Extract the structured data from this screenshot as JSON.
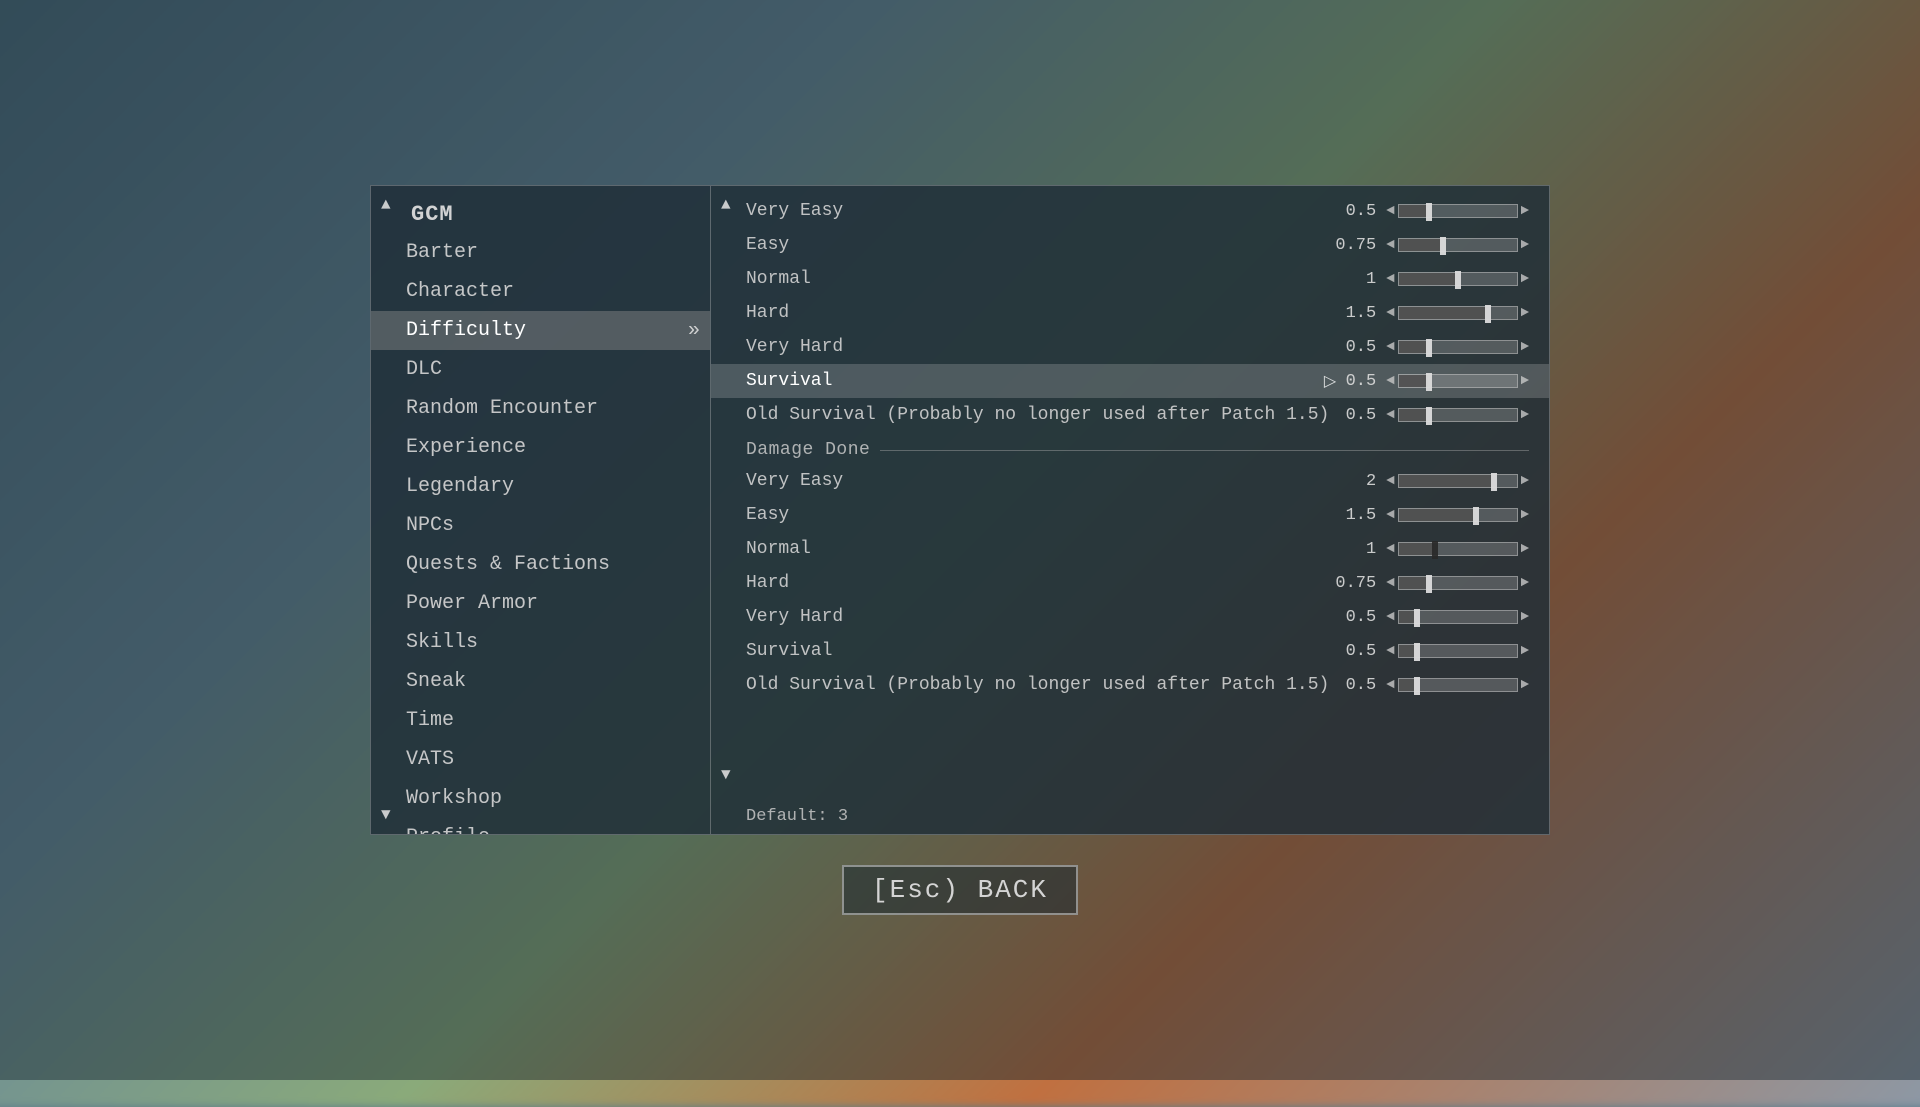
{
  "background": {
    "colors": [
      "#4a6a7a",
      "#6a8a9a",
      "#8aaa7a",
      "#c07040"
    ]
  },
  "left_panel": {
    "collapse_up": "▲",
    "collapse_down": "▼",
    "gcm_label": "GCM",
    "menu_items": [
      {
        "id": "barter",
        "label": "Barter",
        "active": false
      },
      {
        "id": "character",
        "label": "Character",
        "active": false
      },
      {
        "id": "difficulty",
        "label": "Difficulty",
        "active": true
      },
      {
        "id": "dlc",
        "label": "DLC",
        "active": false
      },
      {
        "id": "random-encounter",
        "label": "Random Encounter",
        "active": false
      },
      {
        "id": "experience",
        "label": "Experience",
        "active": false
      },
      {
        "id": "legendary",
        "label": "Legendary",
        "active": false
      },
      {
        "id": "npcs",
        "label": "NPCs",
        "active": false
      },
      {
        "id": "quests-factions",
        "label": "Quests & Factions",
        "active": false
      },
      {
        "id": "power-armor",
        "label": "Power Armor",
        "active": false
      },
      {
        "id": "skills",
        "label": "Skills",
        "active": false
      },
      {
        "id": "sneak",
        "label": "Sneak",
        "active": false
      },
      {
        "id": "time",
        "label": "Time",
        "active": false
      },
      {
        "id": "vats",
        "label": "VATS",
        "active": false
      },
      {
        "id": "workshop",
        "label": "Workshop",
        "active": false
      },
      {
        "id": "profile",
        "label": "Profile",
        "active": false
      }
    ]
  },
  "right_panel": {
    "scroll_up": "▲",
    "scroll_down": "▼",
    "sections": [
      {
        "id": "damage-taken",
        "header": null,
        "rows": [
          {
            "id": "dt-very-easy",
            "name": "Very Easy",
            "value": "0.5",
            "slider_pct": 25,
            "selected": false
          },
          {
            "id": "dt-easy",
            "name": "Easy",
            "value": "0.75",
            "slider_pct": 37,
            "selected": false
          },
          {
            "id": "dt-normal",
            "name": "Normal",
            "value": "1",
            "slider_pct": 50,
            "selected": false
          },
          {
            "id": "dt-hard",
            "name": "Hard",
            "value": "1.5",
            "slider_pct": 75,
            "selected": false
          },
          {
            "id": "dt-very-hard",
            "name": "Very Hard",
            "value": "0.5",
            "slider_pct": 25,
            "selected": false
          },
          {
            "id": "dt-survival",
            "name": "Survival",
            "value": "0.5",
            "slider_pct": 25,
            "selected": true,
            "cursor": true
          },
          {
            "id": "dt-old-survival",
            "name": "Old Survival (Probably no longer used after Patch 1.5)",
            "value": "0.5",
            "slider_pct": 25,
            "selected": false
          }
        ]
      },
      {
        "id": "damage-done",
        "header": "Damage Done",
        "rows": [
          {
            "id": "dd-very-easy",
            "name": "Very Easy",
            "value": "2",
            "slider_pct": 80,
            "selected": false
          },
          {
            "id": "dd-easy",
            "name": "Easy",
            "value": "1.5",
            "slider_pct": 65,
            "selected": false
          },
          {
            "id": "dd-normal",
            "name": "Normal",
            "value": "1",
            "slider_pct": 30,
            "selected": false,
            "dark_thumb": true
          },
          {
            "id": "dd-hard",
            "name": "Hard",
            "value": "0.75",
            "slider_pct": 25,
            "selected": false
          },
          {
            "id": "dd-very-hard",
            "name": "Very Hard",
            "value": "0.5",
            "slider_pct": 15,
            "selected": false
          },
          {
            "id": "dd-survival",
            "name": "Survival",
            "value": "0.5",
            "slider_pct": 15,
            "selected": false
          },
          {
            "id": "dd-old-survival",
            "name": "Old Survival (Probably no longer used after Patch 1.5)",
            "value": "0.5",
            "slider_pct": 15,
            "selected": false
          }
        ]
      }
    ],
    "default_text": "Default: 3"
  },
  "bottom_bar": {
    "esc_label": "[Esc) BACK"
  }
}
